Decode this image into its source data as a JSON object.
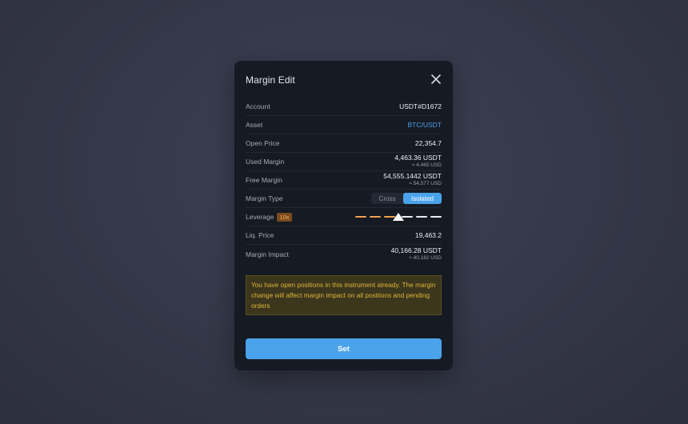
{
  "modal": {
    "title": "Margin Edit",
    "rows": {
      "account": {
        "label": "Account",
        "value": "USDT#D1672"
      },
      "asset": {
        "label": "Asset",
        "value": "BTC/USDT"
      },
      "open_price": {
        "label": "Open Price",
        "value": "22,354.7"
      },
      "used_margin": {
        "label": "Used Margin",
        "value": "4,463.36 USDT",
        "sub": "≈ 4,465 USD"
      },
      "free_margin": {
        "label": "Free Margin",
        "value": "54,555.1442 USDT",
        "sub": "≈ 54,577 USD"
      },
      "margin_type": {
        "label": "Margin Type",
        "options": [
          "Cross",
          "Isolated"
        ],
        "selected": "Isolated"
      },
      "leverage": {
        "label": "Leverage",
        "badge": "10x",
        "level_fraction": 0.5
      },
      "liq_price": {
        "label": "Liq. Price",
        "value": "19,463.2"
      },
      "margin_impact": {
        "label": "Margin Impact",
        "value": "40,166.28 USDT",
        "sub": "≈ 40,182 USD"
      }
    },
    "notice": "You have open positions in this instrument already. The margin change will affect margin impact on all positions and pending orders",
    "set_button": "Set",
    "icons": {
      "close": "close-icon"
    },
    "colors": {
      "accent": "#4aa3ea",
      "leverage_active": "#f0a050",
      "warning_text": "#e0b63a"
    }
  }
}
